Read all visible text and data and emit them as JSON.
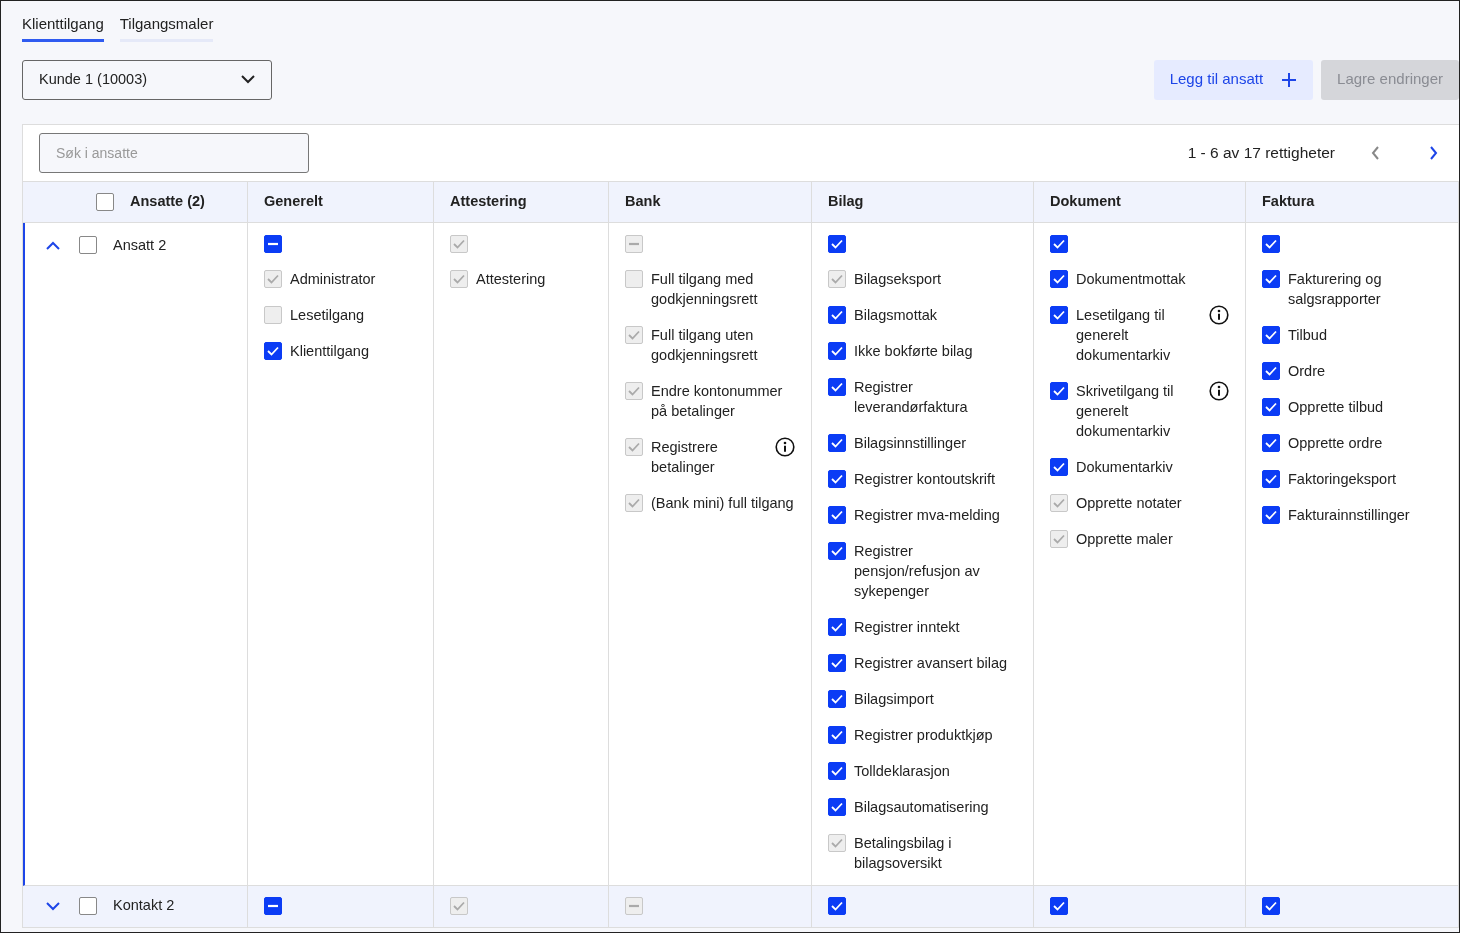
{
  "tabs": [
    {
      "label": "Klienttilgang",
      "selected": true
    },
    {
      "label": "Tilgangsmaler",
      "selected": false
    }
  ],
  "client_select": {
    "value": "Kunde 1 (10003)"
  },
  "buttons": [
    {
      "label": "Legg til ansatt",
      "kind": "add",
      "disabled": false
    },
    {
      "label": "Lagre endringer",
      "kind": "save",
      "disabled": true
    }
  ],
  "search": {
    "placeholder": "Søk i ansatte"
  },
  "pagination": {
    "text": "1 - 6 av 17 rettigheter",
    "prev_disabled": true,
    "next_disabled": false
  },
  "table": {
    "header": {
      "label": "Ansatte (2)",
      "checked": false
    },
    "columns": [
      "Generelt",
      "Attestering",
      "Bank",
      "Bilag",
      "Dokument",
      "Faktura"
    ],
    "rows": [
      {
        "name": "Ansatt 2",
        "checked": false,
        "expanded": true,
        "groups": [
          {
            "checked": true,
            "partial": true,
            "disabled": false,
            "items": [
              {
                "label": "Administrator",
                "checked": true,
                "disabled": true,
                "info": false
              },
              {
                "label": "Lesetilgang",
                "checked": false,
                "disabled": true,
                "info": false
              },
              {
                "label": "Klienttilgang",
                "checked": true,
                "disabled": false,
                "info": false
              }
            ]
          },
          {
            "checked": true,
            "partial": false,
            "disabled": true,
            "items": [
              {
                "label": "Attestering",
                "checked": true,
                "disabled": true,
                "info": false
              }
            ]
          },
          {
            "checked": true,
            "partial": true,
            "disabled": true,
            "items": [
              {
                "label": "Full tilgang med godkjenningsrett",
                "checked": false,
                "disabled": true,
                "info": false
              },
              {
                "label": "Full tilgang uten godkjenningsrett",
                "checked": true,
                "disabled": true,
                "info": false
              },
              {
                "label": "Endre kontonummer på betalinger",
                "checked": true,
                "disabled": true,
                "info": false
              },
              {
                "label": "Registrere betalinger",
                "checked": true,
                "disabled": true,
                "info": true
              },
              {
                "label": "(Bank mini) full tilgang",
                "checked": true,
                "disabled": true,
                "info": false
              }
            ]
          },
          {
            "checked": true,
            "partial": false,
            "disabled": false,
            "items": [
              {
                "label": "Bilagseksport",
                "checked": true,
                "disabled": true,
                "info": false
              },
              {
                "label": "Bilagsmottak",
                "checked": true,
                "disabled": false,
                "info": false
              },
              {
                "label": "Ikke bokførte bilag",
                "checked": true,
                "disabled": false,
                "info": false
              },
              {
                "label": "Registrer leverandørfaktura",
                "checked": true,
                "disabled": false,
                "info": false
              },
              {
                "label": "Bilagsinnstillinger",
                "checked": true,
                "disabled": false,
                "info": false
              },
              {
                "label": "Registrer kontoutskrift",
                "checked": true,
                "disabled": false,
                "info": false
              },
              {
                "label": "Registrer mva-melding",
                "checked": true,
                "disabled": false,
                "info": false
              },
              {
                "label": "Registrer pensjon/refusjon av sykepenger",
                "checked": true,
                "disabled": false,
                "info": false
              },
              {
                "label": "Registrer inntekt",
                "checked": true,
                "disabled": false,
                "info": false
              },
              {
                "label": "Registrer avansert bilag",
                "checked": true,
                "disabled": false,
                "info": false
              },
              {
                "label": "Bilagsimport",
                "checked": true,
                "disabled": false,
                "info": false
              },
              {
                "label": "Registrer produktkjøp",
                "checked": true,
                "disabled": false,
                "info": false
              },
              {
                "label": "Tolldeklarasjon",
                "checked": true,
                "disabled": false,
                "info": false
              },
              {
                "label": "Bilagsautomatisering",
                "checked": true,
                "disabled": false,
                "info": false
              },
              {
                "label": "Betalingsbilag i bilagsoversikt",
                "checked": true,
                "disabled": true,
                "info": false
              }
            ]
          },
          {
            "checked": true,
            "partial": false,
            "disabled": false,
            "items": [
              {
                "label": "Dokumentmottak",
                "checked": true,
                "disabled": false,
                "info": false
              },
              {
                "label": "Lesetilgang til generelt dokumentarkiv",
                "checked": true,
                "disabled": false,
                "info": true
              },
              {
                "label": "Skrivetilgang til generelt dokumentarkiv",
                "checked": true,
                "disabled": false,
                "info": true
              },
              {
                "label": "Dokumentarkiv",
                "checked": true,
                "disabled": false,
                "info": false
              },
              {
                "label": "Opprette notater",
                "checked": true,
                "disabled": true,
                "info": false
              },
              {
                "label": "Opprette maler",
                "checked": true,
                "disabled": true,
                "info": false
              }
            ]
          },
          {
            "checked": true,
            "partial": false,
            "disabled": false,
            "items": [
              {
                "label": "Fakturering og salgsrapporter",
                "checked": true,
                "disabled": false,
                "info": false
              },
              {
                "label": "Tilbud",
                "checked": true,
                "disabled": false,
                "info": false
              },
              {
                "label": "Ordre",
                "checked": true,
                "disabled": false,
                "info": false
              },
              {
                "label": "Opprette tilbud",
                "checked": true,
                "disabled": false,
                "info": false
              },
              {
                "label": "Opprette ordre",
                "checked": true,
                "disabled": false,
                "info": false
              },
              {
                "label": "Faktoringeksport",
                "checked": true,
                "disabled": false,
                "info": false
              },
              {
                "label": "Fakturainnstillinger",
                "checked": true,
                "disabled": false,
                "info": false
              }
            ]
          }
        ]
      },
      {
        "name": "Kontakt 2",
        "checked": false,
        "expanded": false,
        "groups": [
          {
            "checked": true,
            "partial": true,
            "disabled": false
          },
          {
            "checked": true,
            "partial": false,
            "disabled": true
          },
          {
            "checked": true,
            "partial": true,
            "disabled": true
          },
          {
            "checked": true,
            "partial": false,
            "disabled": false
          },
          {
            "checked": true,
            "partial": false,
            "disabled": false
          },
          {
            "checked": true,
            "partial": false,
            "disabled": false
          }
        ]
      }
    ]
  }
}
